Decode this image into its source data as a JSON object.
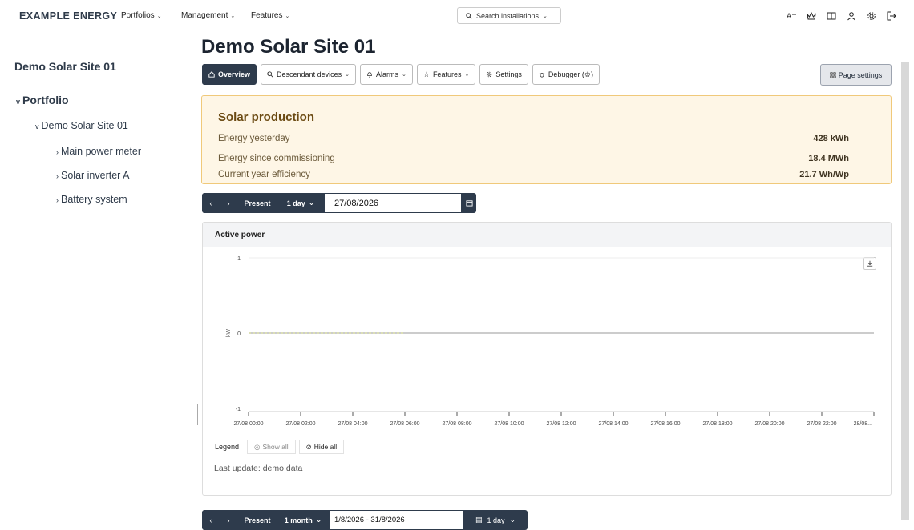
{
  "topbar": {
    "brand": "EXAMPLE ENERGY",
    "nav": [
      {
        "label": "Portfolios"
      },
      {
        "label": "Management"
      },
      {
        "label": "Features"
      }
    ],
    "search_label": "Search installations",
    "icons": [
      "translate-icon",
      "crown-icon",
      "book-icon",
      "user-icon",
      "gear-icon",
      "logout-icon"
    ]
  },
  "sidebar": {
    "site_name": "Demo Solar Site 01",
    "tree": [
      {
        "label": "Portfolio",
        "caret": "v"
      },
      {
        "label": "Demo Solar Site 01",
        "caret": "v"
      },
      {
        "label": "Main power meter",
        "caret": "›"
      },
      {
        "label": "Solar inverter A",
        "caret": "›"
      },
      {
        "label": "Battery system",
        "caret": "›"
      }
    ]
  },
  "main": {
    "title": "Demo Solar Site 01",
    "tabs": [
      {
        "label": "Overview",
        "icon": "home-icon"
      },
      {
        "label": "Descendant devices",
        "icon": "search-icon"
      },
      {
        "label": "Alarms",
        "icon": "bell-icon"
      },
      {
        "label": "Features",
        "icon": "star-icon"
      },
      {
        "label": "Settings",
        "icon": "gear-icon"
      },
      {
        "label": "Debugger (♔)",
        "icon": "bug-icon"
      }
    ],
    "page_settings": "Page settings"
  },
  "solar": {
    "title": "Solar production",
    "rows": [
      {
        "label": "Energy yesterday",
        "value": "428 kWh"
      },
      {
        "label": "Energy since commissioning",
        "value": "18.4 MWh"
      },
      {
        "label": "Current year efficiency",
        "value": "21.7 Wh/Wp"
      }
    ]
  },
  "date_bar": {
    "prev": "‹",
    "next": "›",
    "present": "Present",
    "range": "1 day",
    "date": "27/08/2026"
  },
  "date_bar_2": {
    "prev": "‹",
    "next": "›",
    "present": "Present",
    "range": "1 month",
    "date": "1/8/2026 - 31/8/2026",
    "interval": "1 day"
  },
  "chart_card": {
    "title": "Active power",
    "legend_label": "Legend",
    "show_all": "Show all",
    "hide_all": "Hide all",
    "last_update": "Last update: demo data"
  },
  "chart_data": {
    "type": "line",
    "title": "Active power",
    "ylabel": "kW",
    "ylim": [
      -1,
      1
    ],
    "y_ticks": [
      "1",
      "0",
      "-1"
    ],
    "x_ticks": [
      "27/08 00:00",
      "27/08 02:00",
      "27/08 04:00",
      "27/08 06:00",
      "27/08 08:00",
      "27/08 10:00",
      "27/08 12:00",
      "27/08 14:00",
      "27/08 16:00",
      "27/08 18:00",
      "27/08 20:00",
      "27/08 22:00",
      "28/08..."
    ],
    "series": [
      {
        "color": "#c8cc8a",
        "x_hours": [
          0,
          1,
          2,
          3,
          4,
          5,
          6
        ],
        "values": [
          0,
          0,
          0,
          0,
          0,
          0,
          0
        ]
      }
    ],
    "grid": true,
    "colors": {
      "baseline": "#9a9a9a",
      "grid": "#eeeeee"
    }
  }
}
